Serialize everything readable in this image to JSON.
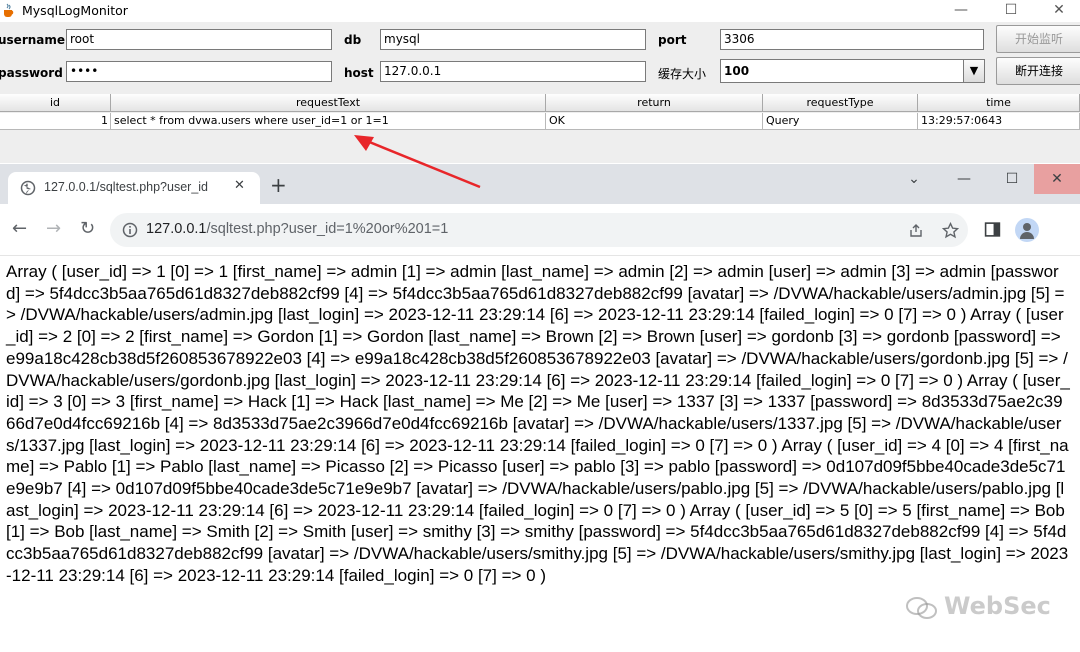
{
  "app": {
    "title": "MysqlLogMonitor",
    "window": {
      "minimize": "—",
      "maximize": "☐",
      "close": "✕"
    },
    "labels": {
      "username": "username",
      "password": "password",
      "db": "db",
      "host": "host",
      "port": "port",
      "cache_size": "缓存大小"
    },
    "fields": {
      "username": "root",
      "password": "••••",
      "db": "mysql",
      "host": "127.0.0.1",
      "port": "3306",
      "cache_size": "100"
    },
    "buttons": {
      "start": "开始监听",
      "disconnect": "断开连接"
    },
    "table": {
      "columns": [
        "id",
        "requestText",
        "return",
        "requestType",
        "time"
      ],
      "rows": [
        {
          "id": "1",
          "requestText": "select * from dvwa.users where user_id=1 or 1=1",
          "return": "OK",
          "requestType": "Query",
          "time": "13:29:57:0643"
        }
      ]
    }
  },
  "browser": {
    "tab_title": "127.0.0.1/sqltest.php?user_id",
    "tab_close": "✕",
    "new_tab": "+",
    "window": {
      "chevron": "⌄",
      "minimize": "—",
      "maximize": "☐",
      "close": "✕"
    },
    "nav": {
      "back": "←",
      "forward": "→",
      "reload": "↻"
    },
    "url_host": "127.0.0.1",
    "url_path": "/sqltest.php?user_id=1%20or%201=1",
    "page_text": "Array ( [user_id] => 1 [0] => 1 [first_name] => admin [1] => admin [last_name] => admin [2] => admin [user] => admin [3] => admin [password] => 5f4dcc3b5aa765d61d8327deb882cf99 [4] => 5f4dcc3b5aa765d61d8327deb882cf99 [avatar] => /DVWA/hackable/users/admin.jpg [5] => /DVWA/hackable/users/admin.jpg [last_login] => 2023-12-11 23:29:14 [6] => 2023-12-11 23:29:14 [failed_login] => 0 [7] => 0 ) Array ( [user_id] => 2 [0] => 2 [first_name] => Gordon [1] => Gordon [last_name] => Brown [2] => Brown [user] => gordonb [3] => gordonb [password] => e99a18c428cb38d5f260853678922e03 [4] => e99a18c428cb38d5f260853678922e03 [avatar] => /DVWA/hackable/users/gordonb.jpg [5] => /DVWA/hackable/users/gordonb.jpg [last_login] => 2023-12-11 23:29:14 [6] => 2023-12-11 23:29:14 [failed_login] => 0 [7] => 0 ) Array ( [user_id] => 3 [0] => 3 [first_name] => Hack [1] => Hack [last_name] => Me [2] => Me [user] => 1337 [3] => 1337 [password] => 8d3533d75ae2c3966d7e0d4fcc69216b [4] => 8d3533d75ae2c3966d7e0d4fcc69216b [avatar] => /DVWA/hackable/users/1337.jpg [5] => /DVWA/hackable/users/1337.jpg [last_login] => 2023-12-11 23:29:14 [6] => 2023-12-11 23:29:14 [failed_login] => 0 [7] => 0 ) Array ( [user_id] => 4 [0] => 4 [first_name] => Pablo [1] => Pablo [last_name] => Picasso [2] => Picasso [user] => pablo [3] => pablo [password] => 0d107d09f5bbe40cade3de5c71e9e9b7 [4] => 0d107d09f5bbe40cade3de5c71e9e9b7 [avatar] => /DVWA/hackable/users/pablo.jpg [5] => /DVWA/hackable/users/pablo.jpg [last_login] => 2023-12-11 23:29:14 [6] => 2023-12-11 23:29:14 [failed_login] => 0 [7] => 0 ) Array ( [user_id] => 5 [0] => 5 [first_name] => Bob [1] => Bob [last_name] => Smith [2] => Smith [user] => smithy [3] => smithy [password] => 5f4dcc3b5aa765d61d8327deb882cf99 [4] => 5f4dcc3b5aa765d61d8327deb882cf99 [avatar] => /DVWA/hackable/users/smithy.jpg [5] => /DVWA/hackable/users/smithy.jpg [last_login] => 2023-12-11 23:29:14 [6] => 2023-12-11 23:29:14 [failed_login] => 0 [7] => 0 )"
  },
  "watermark": "WebSec",
  "colors": {
    "arrow": "#e8262a",
    "close_hover": "#e8a0a0"
  },
  "icons": [
    "java-cup-icon",
    "globe-icon",
    "info-icon",
    "share-icon",
    "star-icon",
    "side-panel-icon",
    "profile-icon",
    "red-arrow"
  ]
}
